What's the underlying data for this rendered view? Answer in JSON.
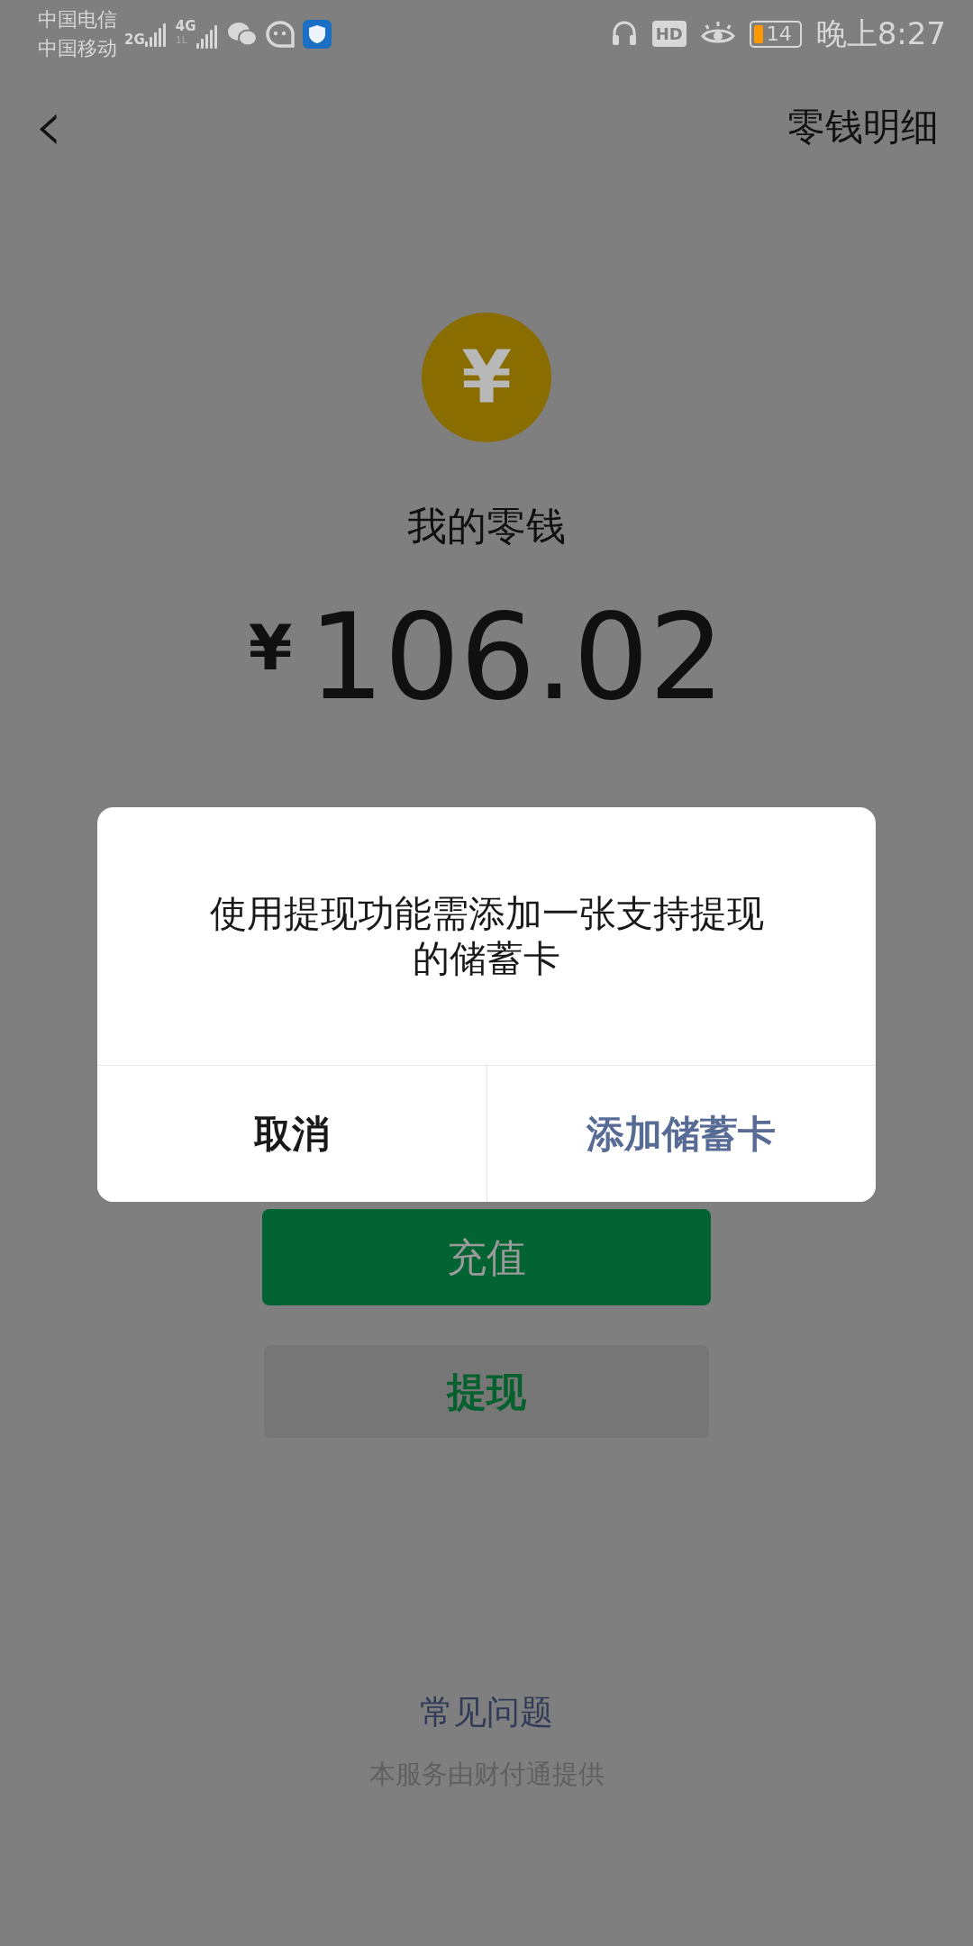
{
  "status_bar": {
    "carriers": [
      "中国电信",
      "中国移动"
    ],
    "networks": [
      {
        "label": "2G"
      },
      {
        "label": "4G",
        "sub": "1L"
      }
    ],
    "hd_badge": "HD",
    "battery": "14",
    "time": "晚上8:27"
  },
  "header": {
    "back": "‹",
    "title": "零钱明细"
  },
  "balance": {
    "coin": "¥",
    "label": "我的零钱",
    "currency": "¥",
    "amount": "106.02"
  },
  "buttons": [
    {
      "label": "充值",
      "kind": "primary"
    },
    {
      "label": "提现",
      "kind": "secondary"
    }
  ],
  "footer": {
    "link": "常见问题",
    "note": "本服务由财付通提供"
  },
  "dialog": {
    "message": "使用提现功能需添加一张支持提现的储蓄卡",
    "actions": [
      {
        "label": "取消",
        "kind": "cancel"
      },
      {
        "label": "添加储蓄卡",
        "kind": "confirm"
      }
    ]
  }
}
